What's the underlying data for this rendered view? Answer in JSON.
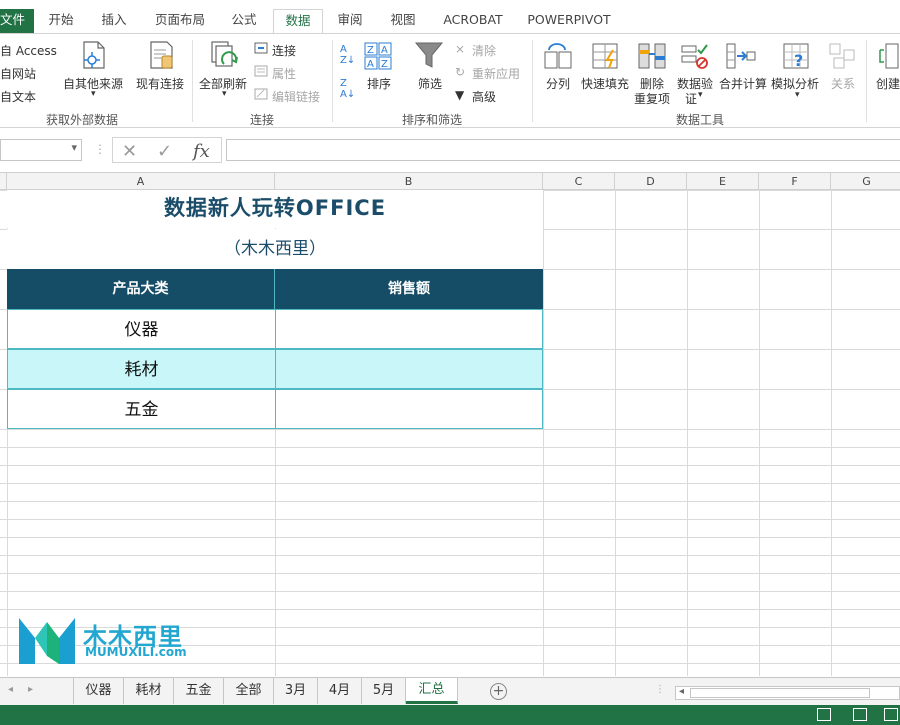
{
  "ribbon_tabs": [
    "文件",
    "开始",
    "插入",
    "页面布局",
    "公式",
    "数据",
    "审阅",
    "视图",
    "ACROBAT",
    "POWERPIVOT"
  ],
  "active_tab": "数据",
  "ribbon": {
    "get_external": {
      "access": "自 Access",
      "web": "自网站",
      "text": "自文本",
      "other_sources": "自其他来源",
      "existing": "现有连接",
      "label": "获取外部数据"
    },
    "connections": {
      "refresh_all": "全部刷新",
      "connections": "连接",
      "properties": "属性",
      "edit_links": "编辑链接",
      "label": "连接"
    },
    "sort_filter": {
      "sort": "排序",
      "filter": "筛选",
      "clear": "清除",
      "reapply": "重新应用",
      "advanced": "高级",
      "label": "排序和筛选"
    },
    "data_tools": {
      "text_to_columns": "分列",
      "flash_fill": "快速填充",
      "remove_dup_1": "删除",
      "remove_dup_2": "重复项",
      "validation_1": "数据验",
      "validation_2": "证",
      "consolidate": "合并计算",
      "what_if": "模拟分析",
      "relationships": "关系",
      "label": "数据工具"
    },
    "outline": {
      "create": "创建"
    }
  },
  "formula_bar": {
    "fx": "fx",
    "cancel": "✕",
    "enter": "✓"
  },
  "columns": [
    "A",
    "B",
    "C",
    "D",
    "E",
    "F",
    "G"
  ],
  "sheet": {
    "title": "数据新人玩转OFFICE",
    "subtitle": "（木木西里）",
    "headers": [
      "产品大类",
      "销售额"
    ],
    "rows": [
      {
        "category": "仪器",
        "sales": ""
      },
      {
        "category": "耗材",
        "sales": ""
      },
      {
        "category": "五金",
        "sales": ""
      }
    ]
  },
  "logo": {
    "cn": "木木西里",
    "en": "MUMUXILI.com"
  },
  "sheet_tabs": [
    "仪器",
    "耗材",
    "五金",
    "全部",
    "3月",
    "4月",
    "5月",
    "汇总"
  ],
  "active_sheet": "汇总",
  "colors": {
    "excel_green": "#217346",
    "header_fill": "#154c66",
    "band_fill": "#c9f7f9",
    "border": "#4fb9c3",
    "title": "#1b4d6a",
    "logo": "#23a7d0"
  }
}
